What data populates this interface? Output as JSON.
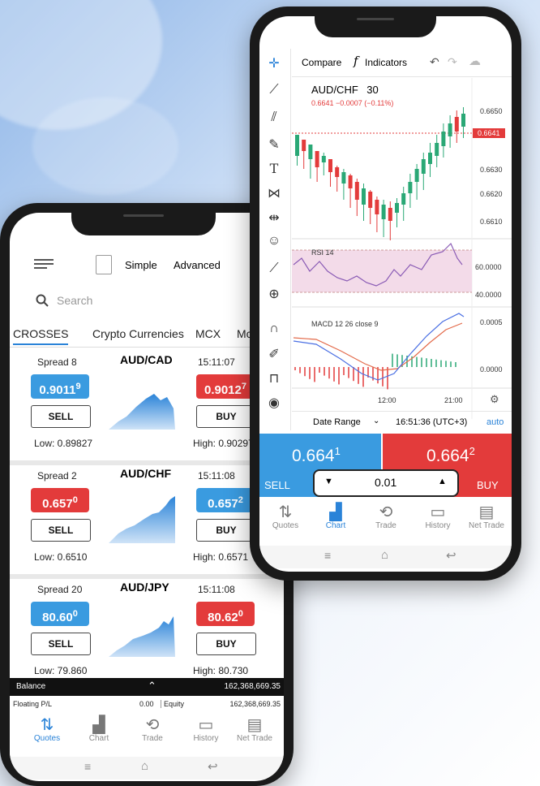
{
  "colors": {
    "accent": "#2a83d8",
    "sell": "#3a9be0",
    "buy": "#e33b3b"
  },
  "left": {
    "topbar": {
      "menu_icon": "menu-icon",
      "toggle_simple": "Simple",
      "toggle_advanced": "Advanced"
    },
    "search": {
      "placeholder": "Search"
    },
    "tabs": [
      "CROSSES",
      "Crypto Currencies",
      "MCX",
      "Mc"
    ],
    "quotes": [
      {
        "spread": "Spread 8",
        "symbol": "AUD/CAD",
        "time": "15:11:07",
        "sell_main": "0.9011",
        "sell_sup": "9",
        "buy_main": "0.9012",
        "buy_sup": "7",
        "sell_color": "blue",
        "buy_color": "red",
        "low": "Low: 0.89827",
        "high": "High: 0.90297"
      },
      {
        "spread": "Spread 2",
        "symbol": "AUD/CHF",
        "time": "15:11:08",
        "sell_main": "0.657",
        "sell_sup": "0",
        "buy_main": "0.657",
        "buy_sup": "2",
        "sell_color": "red",
        "buy_color": "blue",
        "low": "Low: 0.6510",
        "high": "High: 0.6571"
      },
      {
        "spread": "Spread 20",
        "symbol": "AUD/JPY",
        "time": "15:11:08",
        "sell_main": "80.60",
        "sell_sup": "0",
        "buy_main": "80.62",
        "buy_sup": "0",
        "sell_color": "blue",
        "buy_color": "red",
        "low": "Low: 79.860",
        "high": "High: 80.730"
      }
    ],
    "sell_label": "SELL",
    "buy_label": "BUY",
    "balance": {
      "label": "Balance",
      "value": "162,368,669.35"
    },
    "floating": {
      "label": "Floating P/L",
      "value": "0.00",
      "equity_label": "Equity",
      "equity_value": "162,368,669.35"
    },
    "nav": [
      "Quotes",
      "Chart",
      "Trade",
      "History",
      "Net Trade"
    ]
  },
  "right": {
    "toolbar": {
      "compare": "Compare",
      "indicators": "Indicators"
    },
    "chart": {
      "symbol": "AUD/CHF",
      "interval": "30",
      "quote": "0.6641 −0.0007 (−0.11%)",
      "price_tag": "0.6641",
      "y_ticks": [
        "0.6650",
        "0.6630",
        "0.6620",
        "0.6610"
      ]
    },
    "rsi": {
      "label": "RSI 14",
      "ticks": [
        "60.0000",
        "40.0000"
      ]
    },
    "macd": {
      "label": "MACD 12 26 close 9",
      "ticks": [
        "0.0005",
        "0.0000"
      ]
    },
    "time_ticks": [
      "12:00",
      "21:00"
    ],
    "date_range": "Date Range",
    "clock": "16:51:36 (UTC+3)",
    "auto": "auto",
    "sell_main": "0.664",
    "sell_sup": "1",
    "buy_main": "0.664",
    "buy_sup": "2",
    "sell_label": "SELL",
    "buy_label": "BUY",
    "lot": "0.01",
    "nav": [
      "Quotes",
      "Chart",
      "Trade",
      "History",
      "Net Trade"
    ]
  }
}
